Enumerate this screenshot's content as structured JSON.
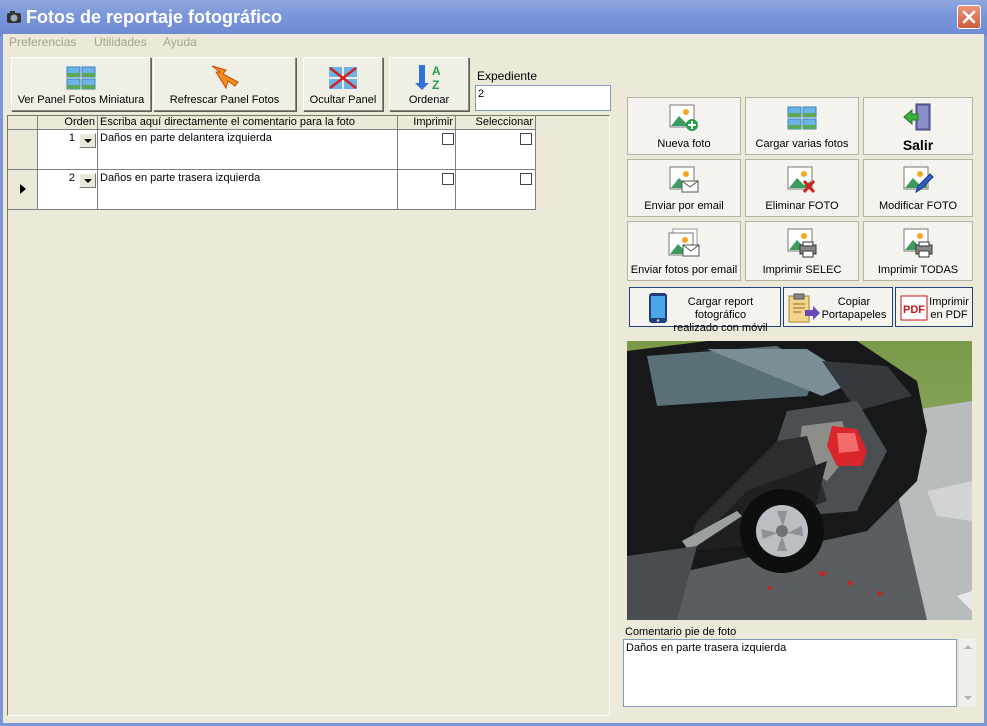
{
  "window": {
    "title": "Fotos de reportaje fotográfico"
  },
  "menu": [
    "Preferencias",
    "Utilidades",
    "Ayuda"
  ],
  "toolbar": {
    "ver_panel": "Ver Panel Fotos Miniatura",
    "refrescar": "Refrescar Panel Fotos",
    "ocultar": "Ocultar Panel",
    "ordenar": "Ordenar"
  },
  "expediente": {
    "label": "Expediente",
    "value": "2"
  },
  "grid": {
    "headers": [
      "Orden",
      "Escriba aquí directamente el comentario para la foto",
      "Imprimir",
      "Seleccionar"
    ],
    "rows": [
      {
        "orden": "1",
        "comentario": "Daños en parte delantera izquierda",
        "imprimir": false,
        "seleccionar": false,
        "current": false
      },
      {
        "orden": "2",
        "comentario": "Daños en parte trasera izquierda",
        "imprimir": false,
        "seleccionar": false,
        "current": true
      }
    ]
  },
  "actions": {
    "nueva_foto": "Nueva foto",
    "cargar_varias": "Cargar varias fotos",
    "salir": "Salir",
    "enviar_email": "Enviar por email",
    "eliminar": "Eliminar FOTO",
    "modificar": "Modificar FOTO",
    "enviar_fotos_email": "Enviar fotos por email",
    "imprimir_selec": "Imprimir SELEC",
    "imprimir_todas": "Imprimir TODAS",
    "cargar_movil_1": "Cargar report fotográfico",
    "cargar_movil_2": "realizado con móvil",
    "copiar_1": "Copiar",
    "copiar_2": "Portapapeles",
    "pdf_1": "Imprimir",
    "pdf_2": "en PDF",
    "pdf_icon_text": "PDF"
  },
  "caption": {
    "label": "Comentario pie de foto",
    "value": "Daños en parte trasera izquierda"
  },
  "colors": {
    "titlebar": "#7c96da",
    "window_bg": "#ece9d8",
    "close_button": "#d9684a"
  }
}
